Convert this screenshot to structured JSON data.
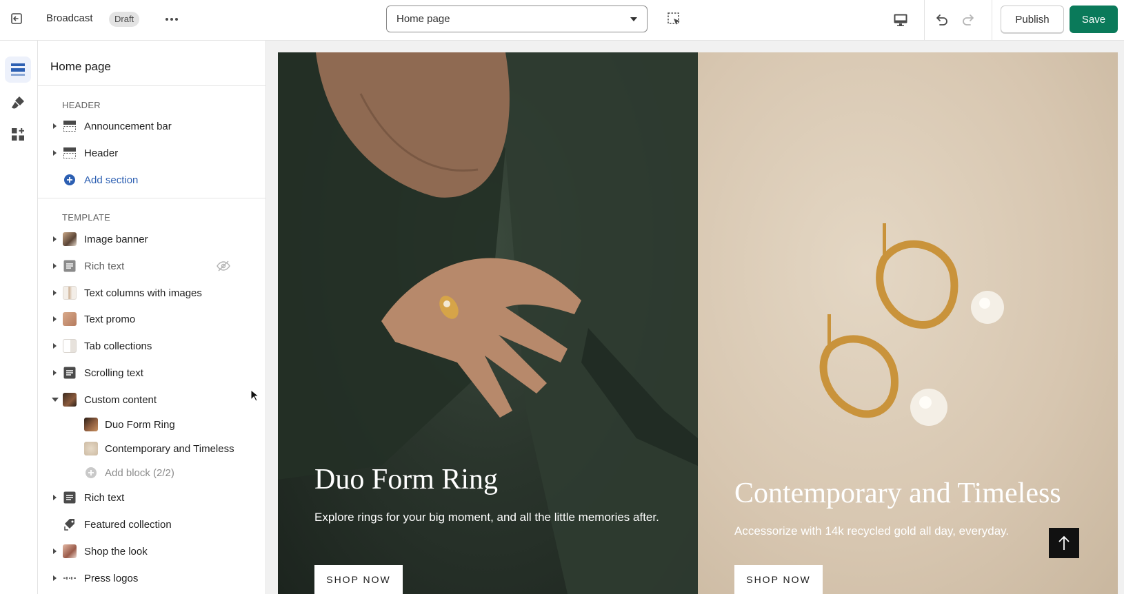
{
  "topbar": {
    "theme_name": "Broadcast",
    "status_badge": "Draft",
    "page_select": "Home page",
    "publish_label": "Publish",
    "save_label": "Save",
    "accent_color": "#0a7a5a"
  },
  "rail": {
    "items": [
      {
        "name": "sections",
        "icon": "sections-icon",
        "active": true
      },
      {
        "name": "theme-settings",
        "icon": "paintbrush-icon",
        "active": false
      },
      {
        "name": "app-embeds",
        "icon": "apps-icon",
        "active": false
      }
    ]
  },
  "sidebar": {
    "title": "Home page",
    "header_group": {
      "label": "HEADER",
      "items": [
        {
          "label": "Announcement bar",
          "icon": "header-section-icon"
        },
        {
          "label": "Header",
          "icon": "header-section-icon"
        }
      ],
      "add_section": "Add section"
    },
    "template_group": {
      "label": "TEMPLATE",
      "items": [
        {
          "label": "Image banner"
        },
        {
          "label": "Rich text",
          "hidden": true
        },
        {
          "label": "Text columns with images"
        },
        {
          "label": "Text promo"
        },
        {
          "label": "Tab collections"
        },
        {
          "label": "Scrolling text"
        },
        {
          "label": "Custom content",
          "expanded": true
        },
        {
          "label": "Rich text"
        },
        {
          "label": "Featured collection"
        },
        {
          "label": "Shop the look"
        },
        {
          "label": "Press logos"
        }
      ],
      "custom_content_blocks": [
        {
          "label": "Duo Form Ring"
        },
        {
          "label": "Contemporary and Timeless"
        }
      ],
      "add_block": "Add block (2/2)"
    }
  },
  "preview": {
    "left": {
      "title": "Duo Form Ring",
      "text": "Explore rings for your big moment, and all the little memories after.",
      "button": "SHOP NOW"
    },
    "right": {
      "title": "Contemporary and Timeless",
      "text": "Accessorize with 14k recycled gold all day, everyday.",
      "button": "SHOP NOW"
    }
  }
}
